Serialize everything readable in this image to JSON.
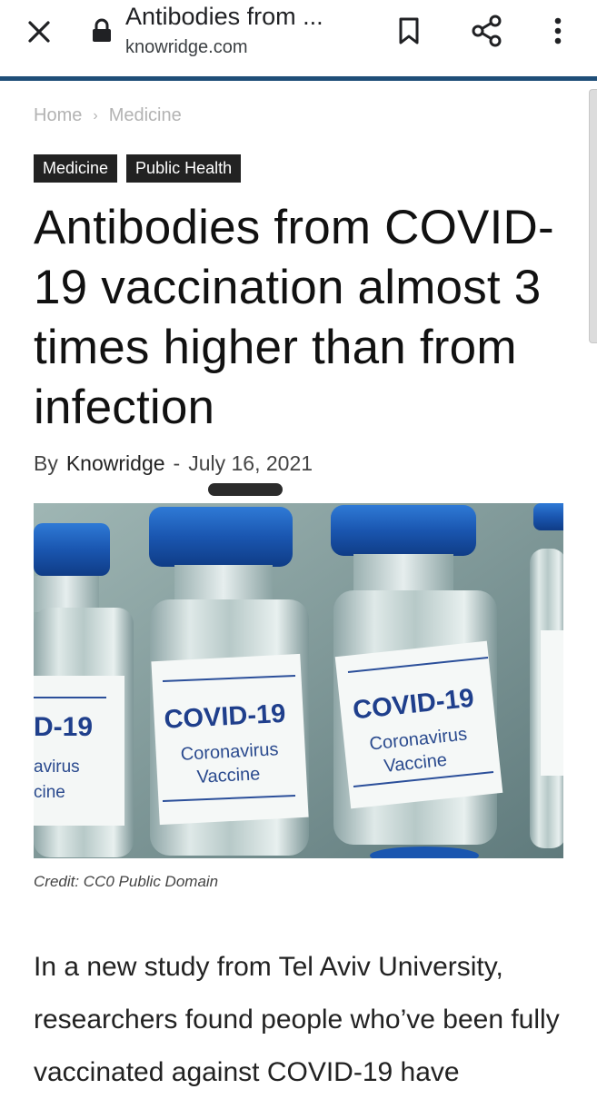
{
  "browser": {
    "title": "Antibodies from ...",
    "url": "knowridge.com",
    "icons": {
      "close": "close-icon",
      "lock": "lock-icon",
      "bookmark": "bookmark-icon",
      "share": "share-icon",
      "menu": "more-vert-icon"
    }
  },
  "breadcrumb": {
    "home": "Home",
    "separator": "›",
    "category": "Medicine"
  },
  "tags": [
    "Medicine",
    "Public Health"
  ],
  "article": {
    "headline": "Antibodies from COVID-19 vaccination almost 3 times higher than from infection",
    "byline_prefix": "By",
    "author": "Knowridge",
    "byline_dash": "-",
    "date": "July 16, 2021",
    "image_caption": "Credit: CC0 Public Domain",
    "image_label_main": "COVID-19",
    "image_label_sub1": "Coronavirus",
    "image_label_sub2": "Vaccine",
    "image_label_partial_main": "D-19",
    "image_label_partial_sub1": "avirus",
    "image_label_partial_sub2": "cine",
    "body_intro": "In a new study from Tel Aviv University, researchers found people who’ve been fully vaccinated against COVID-19 have"
  },
  "colors": {
    "accent_line": "#1f4e78",
    "tag_bg": "#222222",
    "vial_cap": "#1f5fc0",
    "image_bg": "#7f9a9a"
  }
}
